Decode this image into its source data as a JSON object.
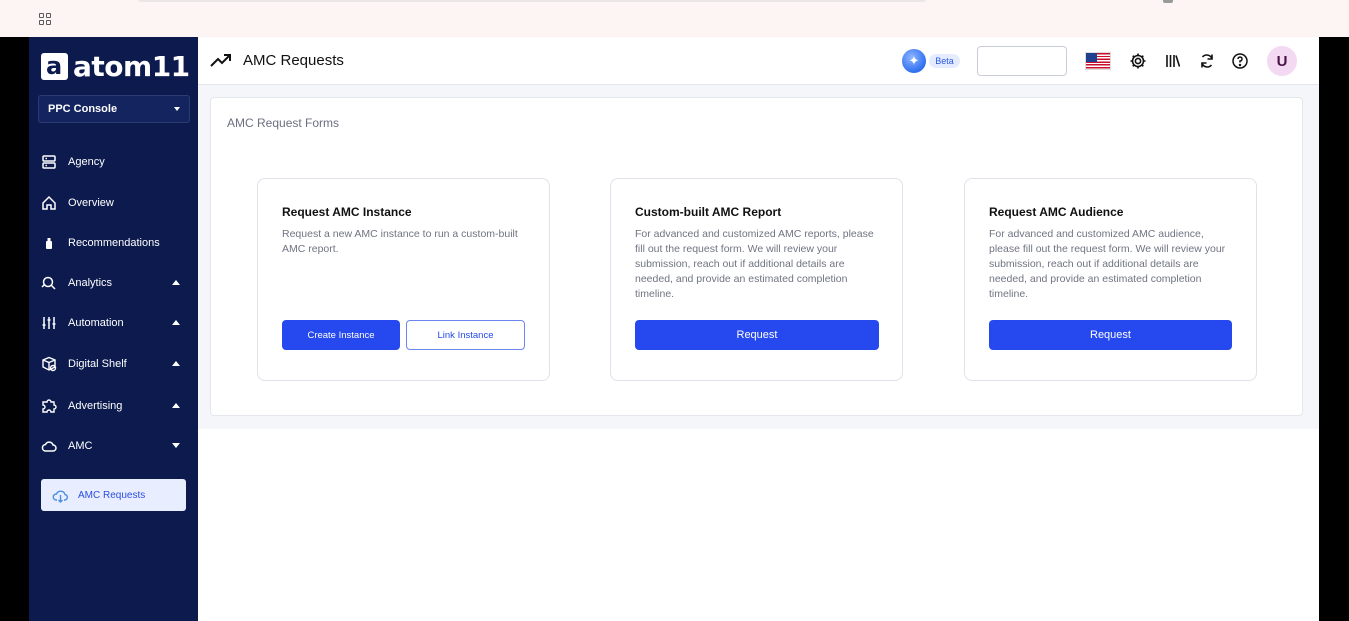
{
  "app": {
    "logo_text": "atom11",
    "console_label": "PPC Console"
  },
  "sidebar": {
    "items": [
      {
        "label": "Agency",
        "icon": "server-icon"
      },
      {
        "label": "Overview",
        "icon": "home-icon"
      },
      {
        "label": "Recommendations",
        "icon": "bulb-icon"
      },
      {
        "label": "Analytics",
        "icon": "analytics-icon"
      },
      {
        "label": "Automation",
        "icon": "sliders-icon"
      },
      {
        "label": "Digital Shelf",
        "icon": "shelf-icon"
      },
      {
        "label": "Advertising",
        "icon": "puzzle-icon"
      },
      {
        "label": "AMC",
        "icon": "cloud-icon"
      }
    ],
    "active_sub_item": {
      "label": "AMC Requests",
      "icon": "cloud-download-icon"
    }
  },
  "header": {
    "title": "AMC Requests",
    "beta_label": "Beta",
    "search_value": "",
    "avatar_initial": "U"
  },
  "panel": {
    "title": "AMC Request Forms",
    "cards": [
      {
        "title": "Request AMC Instance",
        "description": "Request a new AMC instance to run a custom-built AMC report.",
        "primary_button": "Create Instance",
        "secondary_button": "Link Instance"
      },
      {
        "title": "Custom-built AMC Report",
        "description": "For advanced and customized AMC reports, please fill out the request form. We will review your submission, reach out if additional details are needed, and provide an estimated completion timeline.",
        "primary_button": "Request"
      },
      {
        "title": "Request AMC Audience",
        "description": "For advanced and customized AMC audience, please fill out the request form. We will review your submission, reach out if additional details are needed, and provide an estimated completion timeline.",
        "primary_button": "Request"
      }
    ]
  },
  "colors": {
    "sidebar_bg": "#0c1a4e",
    "accent": "#2549ee",
    "active_sub_bg": "#e8edff"
  }
}
